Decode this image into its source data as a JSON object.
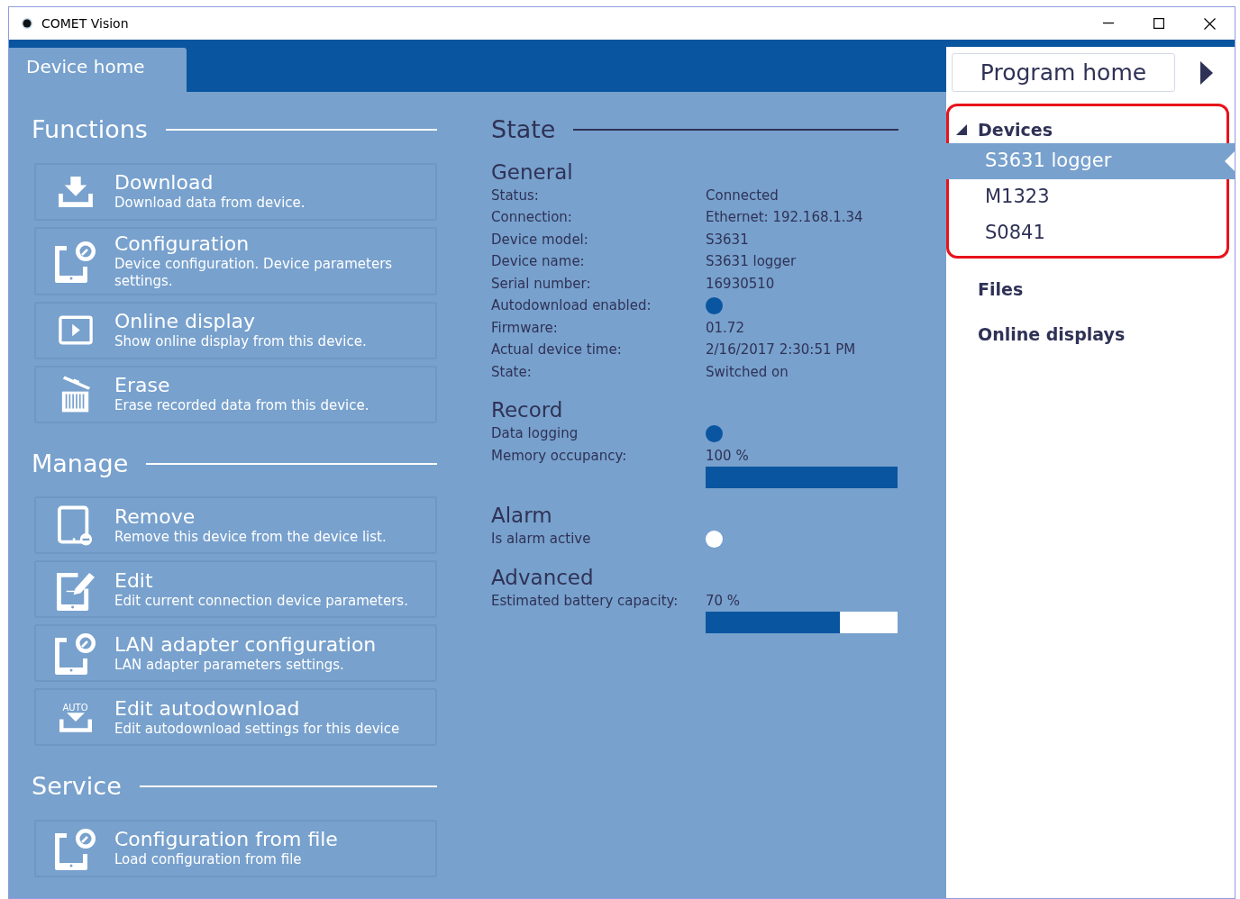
{
  "window": {
    "title": "COMET Vision"
  },
  "tab": {
    "label": "Device home",
    "selected": true
  },
  "sections": [
    {
      "title": "Functions",
      "items": [
        {
          "kind": "download",
          "title": "Download",
          "description": "Download data from device."
        },
        {
          "kind": "config",
          "title": "Configuration",
          "description": "Device configuration. Device parameters settings."
        },
        {
          "kind": "play",
          "title": "Online display",
          "description": "Show online display from this device."
        },
        {
          "kind": "erase",
          "title": "Erase",
          "description": "Erase recorded data from this device."
        }
      ]
    },
    {
      "title": "Manage",
      "items": [
        {
          "kind": "remove",
          "title": "Remove",
          "description": "Remove this device from the device list."
        },
        {
          "kind": "edit",
          "title": "Edit",
          "description": "Edit current connection device parameters."
        },
        {
          "kind": "config",
          "title": "LAN adapter configuration",
          "description": "LAN adapter parameters settings."
        },
        {
          "kind": "auto",
          "icon_label": "AUTO",
          "title": "Edit autodownload",
          "description": "Edit autodownload settings for this device"
        }
      ]
    },
    {
      "title": "Service",
      "items": [
        {
          "kind": "config",
          "title": "Configuration from file",
          "description": "Load configuration from file"
        }
      ]
    }
  ],
  "state": {
    "title": "State",
    "groups": [
      {
        "title": "General",
        "rows": [
          {
            "kind": "text",
            "label": "Status:",
            "value": "Connected"
          },
          {
            "kind": "text",
            "label": "Connection:",
            "value": "Ethernet: 192.168.1.34"
          },
          {
            "kind": "text",
            "label": "Device model:",
            "value": "S3631"
          },
          {
            "kind": "text",
            "label": "Device name:",
            "value": "S3631 logger"
          },
          {
            "kind": "text",
            "label": "Serial number:",
            "value": "16930510"
          },
          {
            "kind": "dot",
            "label": "Autodownload enabled:",
            "on": true
          },
          {
            "kind": "text",
            "label": "Firmware:",
            "value": "01.72"
          },
          {
            "kind": "text",
            "label": "Actual device time:",
            "value": "2/16/2017 2:30:51 PM"
          },
          {
            "kind": "text",
            "label": "State:",
            "value": "Switched on"
          }
        ]
      },
      {
        "title": "Record",
        "rows": [
          {
            "kind": "dot",
            "label": "Data logging",
            "on": true
          },
          {
            "kind": "bar",
            "label": "Memory occupancy:",
            "value": "100 %",
            "level": 1.0
          }
        ]
      },
      {
        "title": "Alarm",
        "rows": [
          {
            "kind": "dot",
            "label": "Is alarm active",
            "on": false
          }
        ]
      },
      {
        "title": "Advanced",
        "rows": [
          {
            "kind": "bar",
            "label": "Estimated battery capacity:",
            "value": "70 %",
            "level": 0.7
          }
        ]
      }
    ]
  },
  "sidebar": {
    "program_home": "Program home",
    "devices": {
      "label": "Devices",
      "expanded": true,
      "items": [
        {
          "label": "S3631 logger",
          "selected": true
        },
        {
          "label": "M1323",
          "selected": false
        },
        {
          "label": "S0841",
          "selected": false
        }
      ]
    },
    "links": [
      "Files",
      "Online displays"
    ]
  }
}
